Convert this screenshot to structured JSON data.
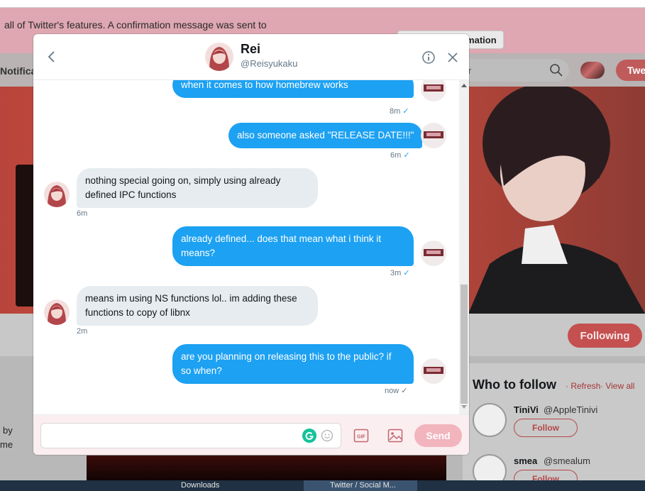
{
  "background": {
    "confirm_text": "all of Twitter's features. A confirmation message was sent to",
    "resend_label": "Resend confirmation",
    "nav_notifications": "Notificat",
    "search_partial": "r",
    "tweet_label": "Twe",
    "following_label": "Following",
    "left_text_1": "by",
    "left_text_2": "me",
    "who_to_follow": {
      "title": "Who to follow",
      "refresh": "· Refresh",
      "view_all": "· View all",
      "items": [
        {
          "name": "TiniVi",
          "handle": "@AppleTinivi",
          "follow": "Follow"
        },
        {
          "name": "smea",
          "handle": "@smealum",
          "follow": "Follow"
        }
      ]
    },
    "taskbar": {
      "item1": "Downloads",
      "item2": "Twitter / Social M..."
    }
  },
  "dm": {
    "name": "Rei",
    "handle": "@Reisyukaku",
    "messages": [
      {
        "side": "sent",
        "lines": [
          "when it comes to how homebrew works"
        ],
        "time": "8m",
        "status": "✓"
      },
      {
        "side": "sent",
        "lines": [
          "also someone asked \"RELEASE DATE!!!\""
        ],
        "time": "6m",
        "status": "✓"
      },
      {
        "side": "recv",
        "lines": [
          "nothing special going on, simply using already",
          "defined IPC functions"
        ],
        "time": "6m"
      },
      {
        "side": "sent",
        "lines": [
          "already defined... does that mean what i think it",
          "means?"
        ],
        "time": "3m",
        "status": "✓"
      },
      {
        "side": "recv",
        "lines": [
          "means im using NS functions lol.. im adding these",
          "functions to copy of libnx"
        ],
        "time": "2m"
      },
      {
        "side": "sent",
        "lines": [
          "are you planning on releasing this to the public? if",
          "so when?"
        ],
        "time": "now",
        "status": "✓"
      }
    ],
    "composer": {
      "placeholder": "",
      "gif_label": "GIF",
      "send_label": "Send"
    }
  },
  "colors": {
    "sent_bubble": "#1da1f2",
    "recv_bubble": "#e6ecf0",
    "send_button": "#f2b4bd"
  }
}
